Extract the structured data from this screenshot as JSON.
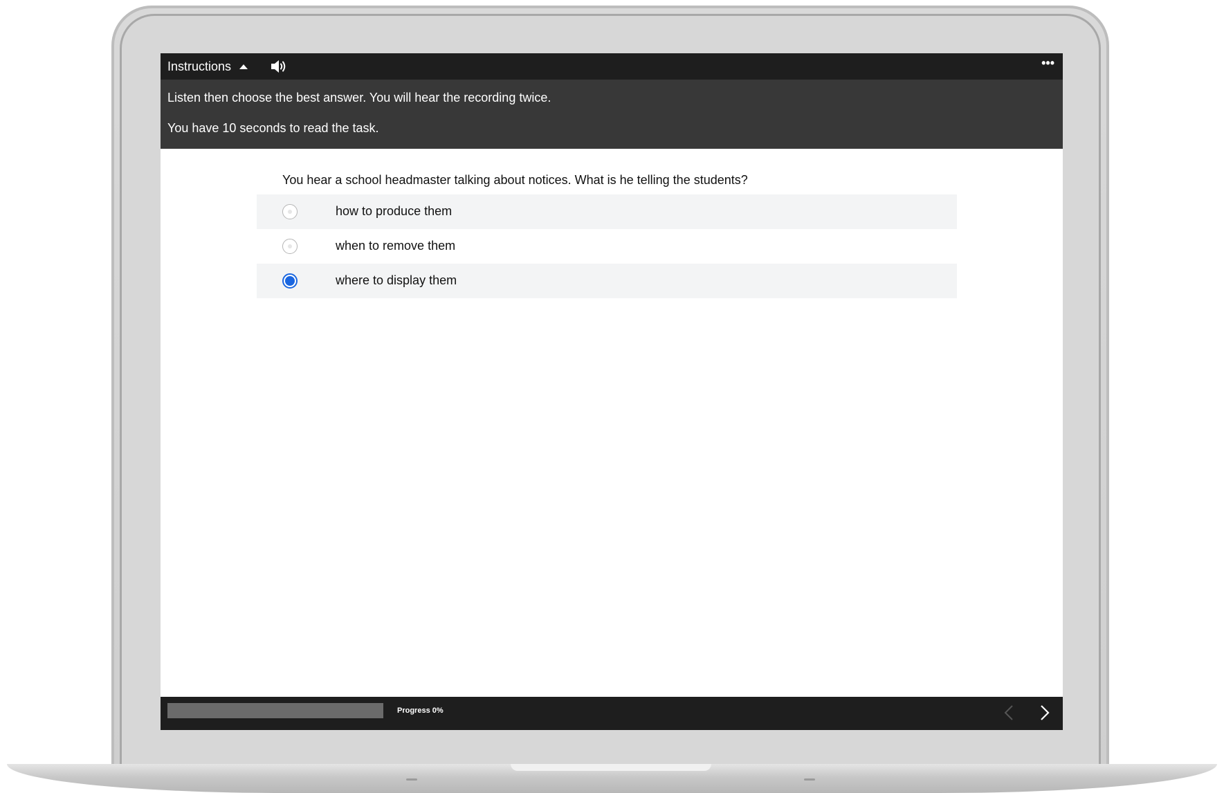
{
  "topbar": {
    "instructions_label": "Instructions",
    "more_label": "•••"
  },
  "instructions": {
    "line1": "Listen then choose the best answer. You will hear the recording twice.",
    "line2": "You have 10 seconds to read the task."
  },
  "question": {
    "text": "You hear a school headmaster talking about notices. What is he telling the students?",
    "options": [
      {
        "label": "how to produce them",
        "selected": false
      },
      {
        "label": "when to remove them",
        "selected": false
      },
      {
        "label": "where to display them",
        "selected": true
      }
    ]
  },
  "footer": {
    "progress_label": "Progress 0%",
    "progress_fraction": 0
  },
  "colors": {
    "accent": "#1a66e0",
    "bar_dark": "#1e1e1e",
    "panel_dark": "#383838"
  },
  "icons": {
    "caret": "caret-up-icon",
    "audio": "speaker-icon",
    "more": "more-horizontal-icon",
    "prev": "chevron-left-icon",
    "next": "chevron-right-icon"
  }
}
